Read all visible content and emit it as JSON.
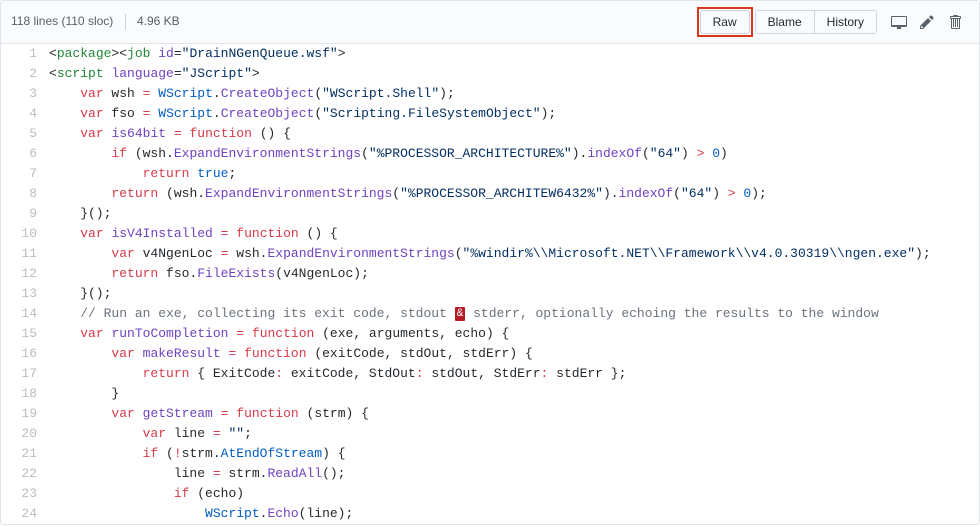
{
  "header": {
    "lines_text": "118 lines (110 sloc)",
    "size_text": "4.96 KB",
    "raw_label": "Raw",
    "blame_label": "Blame",
    "history_label": "History"
  },
  "code": [
    {
      "n": 1,
      "html": "&lt;<span class=\"pl-ent\">package</span>&gt;&lt;<span class=\"pl-ent\">job</span> <span class=\"pl-e\">id</span>=<span class=\"pl-s\">\"DrainNGenQueue.wsf\"</span>&gt;"
    },
    {
      "n": 2,
      "html": "&lt;<span class=\"pl-ent\">script</span> <span class=\"pl-e\">language</span>=<span class=\"pl-s\">\"JScript\"</span>&gt;"
    },
    {
      "n": 3,
      "html": "    <span class=\"pl-k\">var</span> wsh <span class=\"pl-k\">=</span> <span class=\"pl-c1\">WScript</span>.<span class=\"pl-en\">CreateObject</span>(<span class=\"pl-s\">\"WScript.Shell\"</span>);"
    },
    {
      "n": 4,
      "html": "    <span class=\"pl-k\">var</span> fso <span class=\"pl-k\">=</span> <span class=\"pl-c1\">WScript</span>.<span class=\"pl-en\">CreateObject</span>(<span class=\"pl-s\">\"Scripting.FileSystemObject\"</span>);"
    },
    {
      "n": 5,
      "html": "    <span class=\"pl-k\">var</span> <span class=\"pl-en\">is64bit</span> <span class=\"pl-k\">=</span> <span class=\"pl-k\">function</span> () {"
    },
    {
      "n": 6,
      "html": "        <span class=\"pl-k\">if</span> (wsh.<span class=\"pl-en\">ExpandEnvironmentStrings</span>(<span class=\"pl-s\">\"%PROCESSOR_ARCHITECTURE%\"</span>).<span class=\"pl-en\">indexOf</span>(<span class=\"pl-s\">\"64\"</span>) <span class=\"pl-k\">&gt;</span> <span class=\"pl-c1\">0</span>)"
    },
    {
      "n": 7,
      "html": "            <span class=\"pl-k\">return</span> <span class=\"pl-c1\">true</span>;"
    },
    {
      "n": 8,
      "html": "        <span class=\"pl-k\">return</span> (wsh.<span class=\"pl-en\">ExpandEnvironmentStrings</span>(<span class=\"pl-s\">\"%PROCESSOR_ARCHITEW6432%\"</span>).<span class=\"pl-en\">indexOf</span>(<span class=\"pl-s\">\"64\"</span>) <span class=\"pl-k\">&gt;</span> <span class=\"pl-c1\">0</span>);"
    },
    {
      "n": 9,
      "html": "    }();"
    },
    {
      "n": 10,
      "html": "    <span class=\"pl-k\">var</span> <span class=\"pl-en\">isV4Installed</span> <span class=\"pl-k\">=</span> <span class=\"pl-k\">function</span> () {"
    },
    {
      "n": 11,
      "html": "        <span class=\"pl-k\">var</span> v4NgenLoc <span class=\"pl-k\">=</span> wsh.<span class=\"pl-en\">ExpandEnvironmentStrings</span>(<span class=\"pl-s\">\"%windir%\\\\Microsoft.NET\\\\Framework\\\\v4.0.30319\\\\ngen.exe\"</span>);"
    },
    {
      "n": 12,
      "html": "        <span class=\"pl-k\">return</span> fso.<span class=\"pl-en\">FileExists</span>(v4NgenLoc);"
    },
    {
      "n": 13,
      "html": "    }();"
    },
    {
      "n": 14,
      "html": "    <span class=\"pl-c\">// Run an exe, collecting its exit code, stdout <span class=\"pl-err\">&amp;</span> stderr, optionally echoing the results to the window</span>"
    },
    {
      "n": 15,
      "html": "    <span class=\"pl-k\">var</span> <span class=\"pl-en\">runToCompletion</span> <span class=\"pl-k\">=</span> <span class=\"pl-k\">function</span> (exe, arguments, echo) {"
    },
    {
      "n": 16,
      "html": "        <span class=\"pl-k\">var</span> <span class=\"pl-en\">makeResult</span> <span class=\"pl-k\">=</span> <span class=\"pl-k\">function</span> (exitCode, stdOut, stdErr) {"
    },
    {
      "n": 17,
      "html": "            <span class=\"pl-k\">return</span> { ExitCode<span class=\"pl-k\">:</span> exitCode, StdOut<span class=\"pl-k\">:</span> stdOut, StdErr<span class=\"pl-k\">:</span> stdErr };"
    },
    {
      "n": 18,
      "html": "        }"
    },
    {
      "n": 19,
      "html": "        <span class=\"pl-k\">var</span> <span class=\"pl-en\">getStream</span> <span class=\"pl-k\">=</span> <span class=\"pl-k\">function</span> (strm) {"
    },
    {
      "n": 20,
      "html": "            <span class=\"pl-k\">var</span> line <span class=\"pl-k\">=</span> <span class=\"pl-s\">\"\"</span>;"
    },
    {
      "n": 21,
      "html": "            <span class=\"pl-k\">if</span> (<span class=\"pl-k\">!</span>strm.<span class=\"pl-c1\">AtEndOfStream</span>) {"
    },
    {
      "n": 22,
      "html": "                line <span class=\"pl-k\">=</span> strm.<span class=\"pl-en\">ReadAll</span>();"
    },
    {
      "n": 23,
      "html": "                <span class=\"pl-k\">if</span> (echo)"
    },
    {
      "n": 24,
      "html": "                    <span class=\"pl-c1\">WScript</span>.<span class=\"pl-en\">Echo</span>(line);"
    }
  ]
}
